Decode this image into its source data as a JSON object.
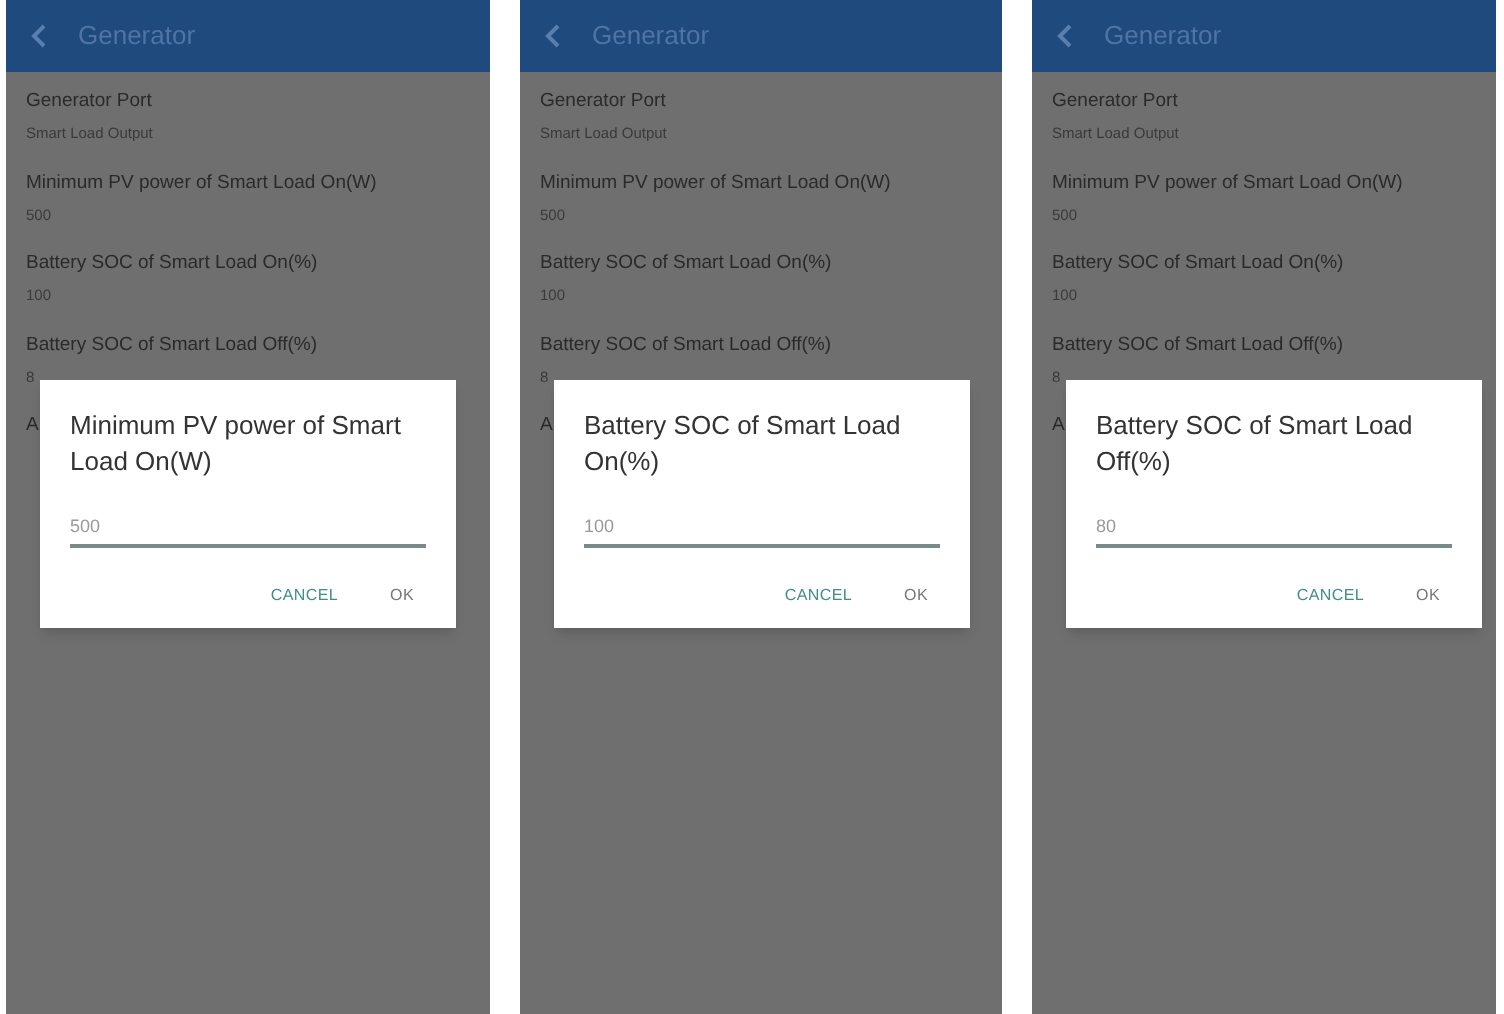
{
  "screens": [
    {
      "header": {
        "title": "Generator"
      },
      "items": [
        {
          "label": "Generator Port",
          "value": "Smart Load Output"
        },
        {
          "label": "Minimum PV power of Smart Load On(W)",
          "value": "500"
        },
        {
          "label": "Battery SOC of Smart Load On(%)",
          "value": "100"
        },
        {
          "label": "Battery SOC of Smart Load Off(%)",
          "value": "8"
        },
        {
          "label": "A"
        }
      ],
      "dialog": {
        "title": "Minimum PV power of Smart Load On(W)",
        "value": "500",
        "buttons": [
          {
            "label": "CANCEL",
            "kind": "accent"
          },
          {
            "label": "OK",
            "kind": "plain"
          }
        ]
      }
    },
    {
      "header": {
        "title": "Generator"
      },
      "items": [
        {
          "label": "Generator Port",
          "value": "Smart Load Output"
        },
        {
          "label": "Minimum PV power of Smart Load On(W)",
          "value": "500"
        },
        {
          "label": "Battery SOC of Smart Load On(%)",
          "value": "100"
        },
        {
          "label": "Battery SOC of Smart Load Off(%)",
          "value": "8"
        },
        {
          "label": "A"
        }
      ],
      "dialog": {
        "title": "Battery SOC of Smart Load On(%)",
        "value": "100",
        "buttons": [
          {
            "label": "CANCEL",
            "kind": "accent"
          },
          {
            "label": "OK",
            "kind": "plain"
          }
        ]
      }
    },
    {
      "header": {
        "title": "Generator"
      },
      "items": [
        {
          "label": "Generator Port",
          "value": "Smart Load Output"
        },
        {
          "label": "Minimum PV power of Smart Load On(W)",
          "value": "500"
        },
        {
          "label": "Battery SOC of Smart Load On(%)",
          "value": "100"
        },
        {
          "label": "Battery SOC of Smart Load Off(%)",
          "value": "8"
        },
        {
          "label": "A"
        }
      ],
      "dialog": {
        "title": "Battery SOC of Smart Load Off(%)",
        "value": "80",
        "buttons": [
          {
            "label": "CANCEL",
            "kind": "accent"
          },
          {
            "label": "OK",
            "kind": "plain"
          }
        ]
      }
    }
  ]
}
